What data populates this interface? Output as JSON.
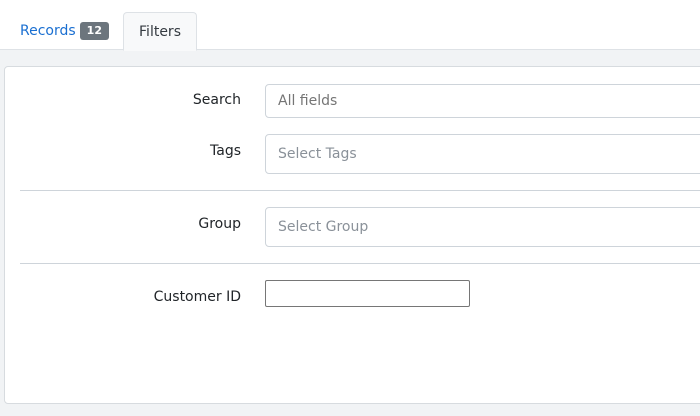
{
  "tabs": {
    "records_label": "Records",
    "records_count": "12",
    "filters_label": "Filters"
  },
  "filters": {
    "search_label": "Search",
    "search_placeholder": "All fields",
    "tags_label": "Tags",
    "tags_placeholder": "Select Tags",
    "group_label": "Group",
    "group_placeholder": "Select Group",
    "customer_id_label": "Customer ID",
    "customer_id_value": ""
  }
}
